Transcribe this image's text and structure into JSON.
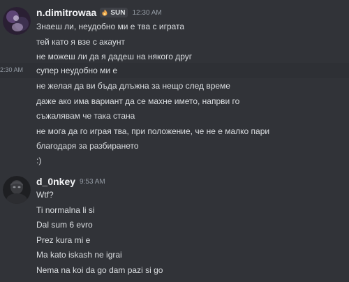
{
  "messages": [
    {
      "author": "n.dimitrowaa",
      "tag": "SUN",
      "tag_icon": "flame-icon",
      "time": "12:30 AM",
      "lines": [
        "Знаеш ли, неудобно ми е тва с играта",
        "тей като я взе с акаунт",
        "не можеш ли да я дадеш на някого друг",
        "супер неудобно ми е",
        "не желая да ви бъда длъжна за нещо след време",
        "даже ако има вариант да се махне името, напрви го",
        "съжалявам че така стана",
        "не мога да го играя тва, при положение, че не е малко пари",
        "благодаря за разбирането",
        ":)"
      ],
      "hover_time": "2:30 AM"
    },
    {
      "author": "d_0nkey",
      "time": "9:53 AM",
      "lines": [
        "Wtf?",
        "Ti normalna li si",
        "Dal sum 6 evro",
        "Prez kura mi e",
        "Ma kato iskash ne igrai",
        "Nema na koi da go dam pazi si go"
      ]
    }
  ],
  "colors": {
    "background": "#313338",
    "hover_background": "#2e3035",
    "text": "#dbdee1",
    "username": "#f2f3f5",
    "timestamp": "#949ba4"
  }
}
